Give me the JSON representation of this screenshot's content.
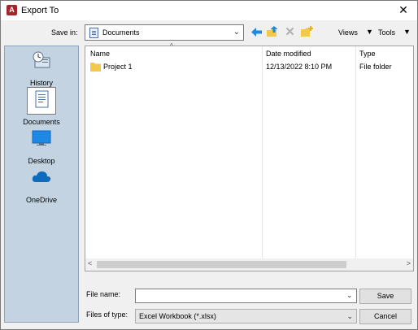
{
  "window": {
    "title": "Export To",
    "close_glyph": "✕"
  },
  "app_icon": {
    "name": "access-app-icon",
    "glyph": "A",
    "color": "#a4262c"
  },
  "toolbar": {
    "save_in_label": "Save in:",
    "save_in_value": "Documents",
    "views_label": "Views",
    "tools_label": "Tools",
    "icons": [
      "back-arrow-icon",
      "up-folder-icon",
      "delete-icon",
      "new-folder-icon"
    ]
  },
  "places": [
    {
      "label": "History",
      "icon": "history-icon",
      "selected": false
    },
    {
      "label": "Documents",
      "icon": "documents-icon",
      "selected": true
    },
    {
      "label": "Desktop",
      "icon": "desktop-icon",
      "selected": false
    },
    {
      "label": "OneDrive",
      "icon": "onedrive-icon",
      "selected": false
    }
  ],
  "file_list": {
    "columns": [
      "Name",
      "Date modified",
      "Type"
    ],
    "rows": [
      {
        "name": "Project 1",
        "date": "12/13/2022 8:10 PM",
        "type": "File folder",
        "icon": "folder-icon"
      }
    ]
  },
  "bottom": {
    "file_name_label": "File name:",
    "file_name_value": "",
    "files_of_type_label": "Files of type:",
    "files_of_type_value": "Excel Workbook (*.xlsx)",
    "save_label": "Save",
    "cancel_label": "Cancel"
  },
  "colors": {
    "places_bg": "#c3d3e2",
    "accent": "#1e88e5",
    "folder": "#f2c94c"
  }
}
